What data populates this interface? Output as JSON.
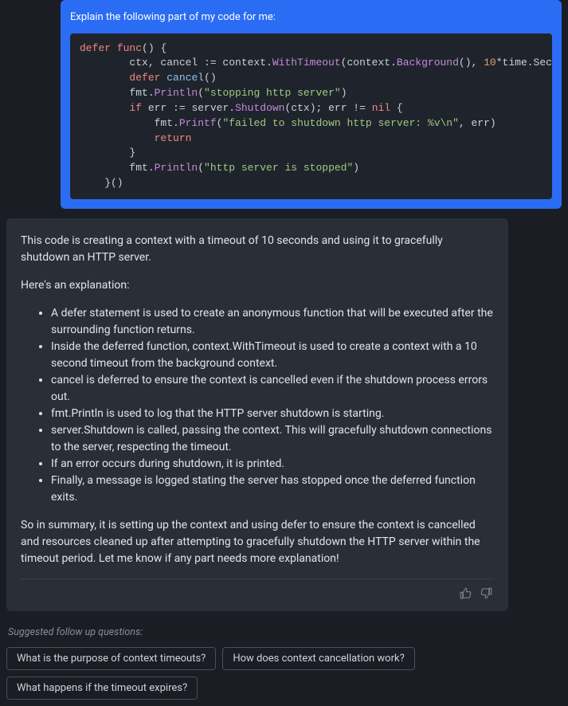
{
  "user_prompt": "Explain the following part of my code for me:",
  "code": {
    "tokens": [
      {
        "t": "kw",
        "v": "defer"
      },
      {
        "t": "plain",
        "v": " "
      },
      {
        "t": "kw",
        "v": "func"
      },
      {
        "t": "plain",
        "v": "() {\n        ctx, cancel := context."
      },
      {
        "t": "func",
        "v": "WithTimeout"
      },
      {
        "t": "plain",
        "v": "(context."
      },
      {
        "t": "func",
        "v": "Background"
      },
      {
        "t": "plain",
        "v": "(), "
      },
      {
        "t": "num",
        "v": "10"
      },
      {
        "t": "plain",
        "v": "*time.Sec\n        "
      },
      {
        "t": "kw",
        "v": "defer"
      },
      {
        "t": "plain",
        "v": " "
      },
      {
        "t": "ident",
        "v": "cancel"
      },
      {
        "t": "plain",
        "v": "()\n        fmt."
      },
      {
        "t": "func",
        "v": "Println"
      },
      {
        "t": "plain",
        "v": "("
      },
      {
        "t": "str",
        "v": "\"stopping http server\""
      },
      {
        "t": "plain",
        "v": ")\n        "
      },
      {
        "t": "kw",
        "v": "if"
      },
      {
        "t": "plain",
        "v": " err := server."
      },
      {
        "t": "func",
        "v": "Shutdown"
      },
      {
        "t": "plain",
        "v": "(ctx); err != "
      },
      {
        "t": "kw",
        "v": "nil"
      },
      {
        "t": "plain",
        "v": " {\n            fmt."
      },
      {
        "t": "func",
        "v": "Printf"
      },
      {
        "t": "plain",
        "v": "("
      },
      {
        "t": "str",
        "v": "\"failed to shutdown http server: %v\\n\""
      },
      {
        "t": "plain",
        "v": ", err)\n            "
      },
      {
        "t": "kw",
        "v": "return"
      },
      {
        "t": "plain",
        "v": "\n        }\n        fmt."
      },
      {
        "t": "func",
        "v": "Println"
      },
      {
        "t": "plain",
        "v": "("
      },
      {
        "t": "str",
        "v": "\"http server is stopped\""
      },
      {
        "t": "plain",
        "v": ")\n    }()"
      }
    ]
  },
  "reply": {
    "p1": "This code is creating a context with a timeout of 10 seconds and using it to gracefully shutdown an HTTP server.",
    "p2": "Here's an explanation:",
    "bullets": [
      "A defer statement is used to create an anonymous function that will be executed after the surrounding function returns.",
      "Inside the deferred function, context.WithTimeout is used to create a context with a 10 second timeout from the background context.",
      "cancel is deferred to ensure the context is cancelled even if the shutdown process errors out.",
      "fmt.Println is used to log that the HTTP server shutdown is starting.",
      "server.Shutdown is called, passing the context. This will gracefully shutdown connections to the server, respecting the timeout.",
      "If an error occurs during shutdown, it is printed.",
      "Finally, a message is logged stating the server has stopped once the deferred function exits."
    ],
    "p3": "So in summary, it is setting up the context and using defer to ensure the context is cancelled and resources cleaned up after attempting to gracefully shutdown the HTTP server within the timeout period. Let me know if any part needs more explanation!"
  },
  "suggestions": {
    "label": "Suggested follow up questions:",
    "items": [
      "What is the purpose of context timeouts?",
      "How does context cancellation work?",
      "What happens if the timeout expires?"
    ]
  }
}
